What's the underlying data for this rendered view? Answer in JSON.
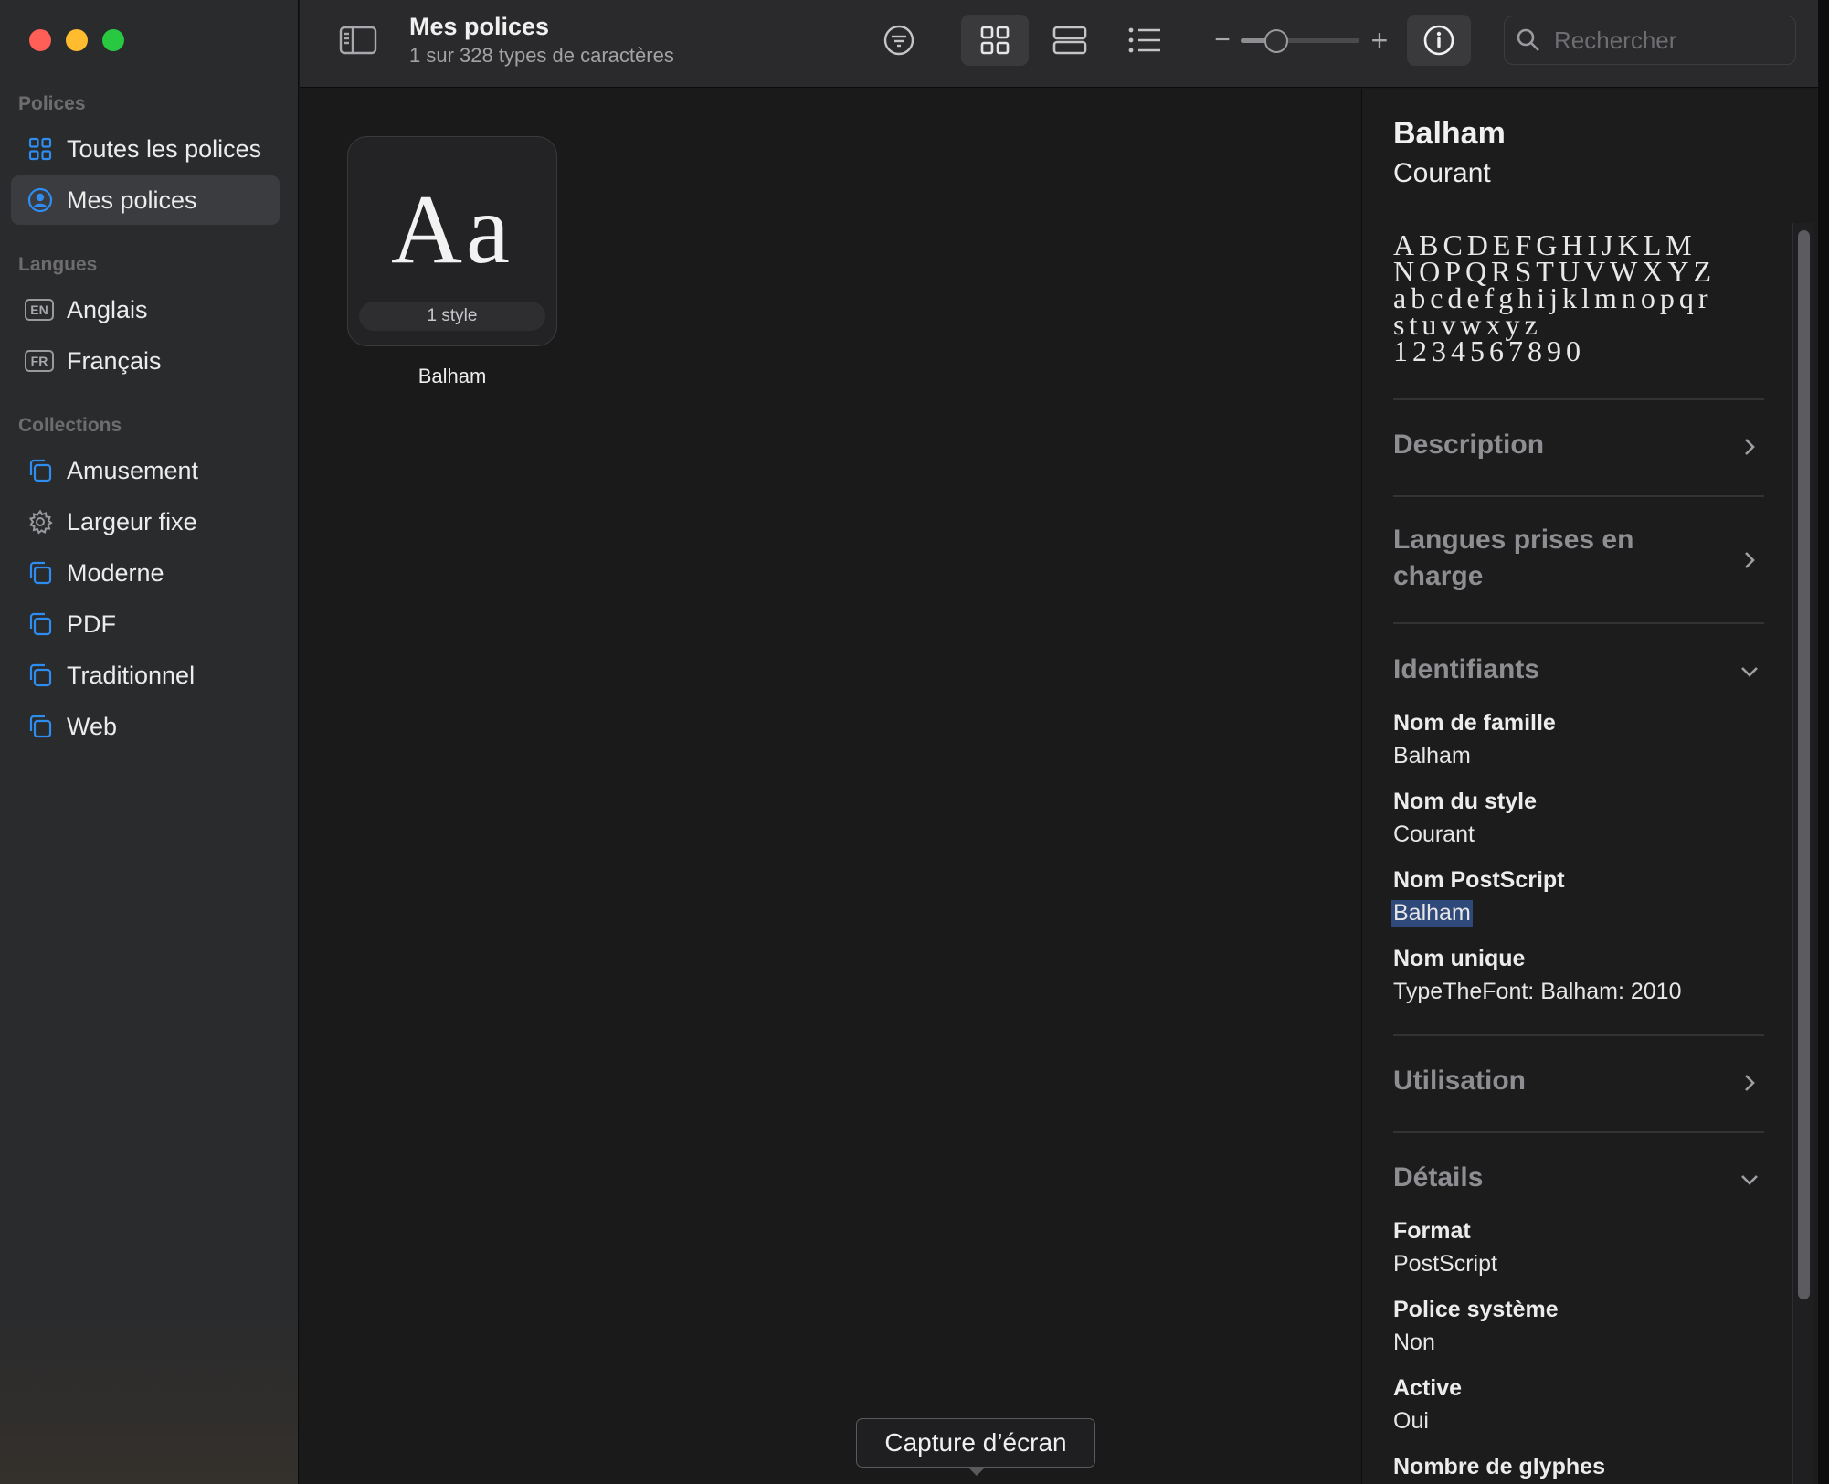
{
  "toolbar": {
    "title": "Mes polices",
    "subtitle": "1 sur 328 types de caractères",
    "search_placeholder": "Rechercher",
    "zoom_minus": "−",
    "zoom_plus": "+",
    "zoom_level": 0.3
  },
  "sidebar": {
    "sections": {
      "fonts": "Polices",
      "languages": "Langues",
      "collections": "Collections"
    },
    "font_items": [
      {
        "label": "Toutes les polices",
        "icon": "grid-icon"
      },
      {
        "label": "Mes polices",
        "icon": "person-circle-icon",
        "selected": true
      }
    ],
    "language_items": [
      {
        "label": "Anglais",
        "badge": "EN"
      },
      {
        "label": "Français",
        "badge": "FR"
      }
    ],
    "collection_items": [
      {
        "label": "Amusement",
        "icon": "collection-icon"
      },
      {
        "label": "Largeur fixe",
        "icon": "gear-icon"
      },
      {
        "label": "Moderne",
        "icon": "collection-icon"
      },
      {
        "label": "PDF",
        "icon": "collection-icon"
      },
      {
        "label": "Traditionnel",
        "icon": "collection-icon"
      },
      {
        "label": "Web",
        "icon": "collection-icon"
      }
    ]
  },
  "grid": {
    "card": {
      "sample": "Aa",
      "styles": "1 style",
      "name": "Balham"
    }
  },
  "tooltip": "Capture d’écran",
  "info": {
    "family": "Balham",
    "style": "Courant",
    "glyph_lines": [
      "ABCDEFGHIJKLM",
      "NOPQRSTUVWXYZ",
      "abcdefghijklmnopqr",
      "stuvwxyz",
      "1234567890"
    ],
    "sections": {
      "description": "Description",
      "languages": "Langues prises en charge",
      "identifiers": "Identifiants",
      "usage": "Utilisation",
      "details": "Détails"
    },
    "identifiers": [
      {
        "label": "Nom de famille",
        "value": "Balham"
      },
      {
        "label": "Nom du style",
        "value": "Courant"
      },
      {
        "label": "Nom PostScript",
        "value": "Balham"
      },
      {
        "label": "Nom unique",
        "value": "TypeTheFont: Balham: 2010"
      }
    ],
    "details": [
      {
        "label": "Format",
        "value": "PostScript"
      },
      {
        "label": "Police système",
        "value": "Non"
      },
      {
        "label": "Active",
        "value": "Oui"
      },
      {
        "label": "Nombre de glyphes",
        "value": ""
      }
    ]
  },
  "colors": {
    "accent": "#0a84ff",
    "selection": "#2f4a7a",
    "traffic_red": "#ff5f57",
    "traffic_yellow": "#febc2e",
    "traffic_green": "#28c840"
  }
}
